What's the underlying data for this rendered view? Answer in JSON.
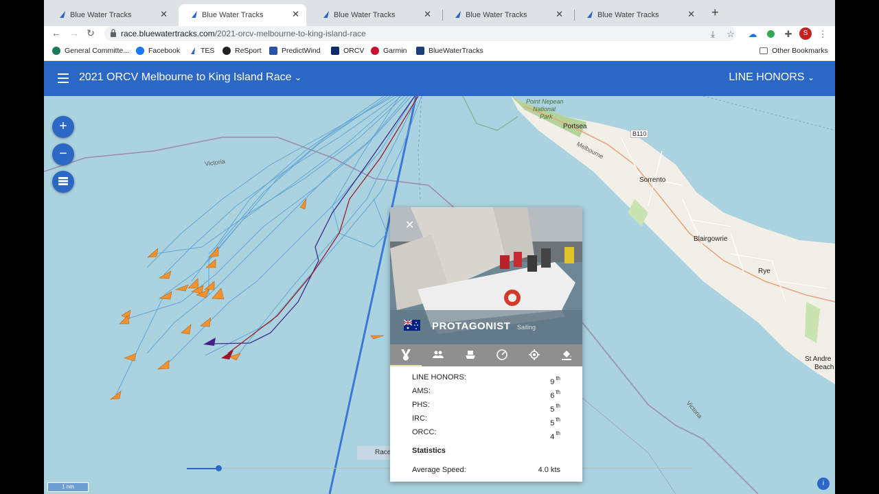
{
  "browser": {
    "tabs": [
      {
        "title": "Blue Water Tracks",
        "active": false
      },
      {
        "title": "Blue Water Tracks",
        "active": true
      },
      {
        "title": "Blue Water Tracks",
        "active": false
      },
      {
        "title": "Blue Water Tracks",
        "active": false
      },
      {
        "title": "Blue Water Tracks",
        "active": false
      }
    ],
    "url_host": "race.bluewatertracks.com",
    "url_path": "/2021-orcv-melbourne-to-king-island-race",
    "profile_initial": "S",
    "bookmarks": [
      "General Committe...",
      "Facebook",
      "TES",
      "ReSport",
      "PredictWind",
      "ORCV",
      "Garmin",
      "BlueWaterTracks"
    ],
    "other_bookmarks": "Other Bookmarks"
  },
  "app": {
    "title": "2021 ORCV Melbourne to King Island Race",
    "classification": "LINE HONORS",
    "accent": "#2b67c4"
  },
  "map": {
    "labels": {
      "point_nepean_1": "Point Nepean",
      "point_nepean_2": "National",
      "point_nepean_3": "Park",
      "portsea": "Portsea",
      "b110": "B110",
      "melbourne": "Melbourne",
      "sorrento": "Sorrento",
      "blairgowrie": "Blairgowrie",
      "rye": "Rye",
      "st_andrews_1": "St Andre",
      "st_andrews_2": "Beach",
      "victoria_1": "Victoria",
      "victoria_2": "Victoria"
    },
    "scale": "1 nm",
    "race_label": "Race",
    "info": "i"
  },
  "popup": {
    "boat_name": "PROTAGONIST",
    "boat_sub": "Sailing",
    "placings": [
      {
        "label": "LINE HONORS:",
        "value": "9",
        "suffix": "th"
      },
      {
        "label": "AMS:",
        "value": "6",
        "suffix": "th"
      },
      {
        "label": "PHS:",
        "value": "5",
        "suffix": "th"
      },
      {
        "label": "IRC:",
        "value": "5",
        "suffix": "th"
      },
      {
        "label": "ORCC:",
        "value": "4",
        "suffix": "th"
      }
    ],
    "statistics_heading": "Statistics",
    "average_speed_label": "Average Speed:",
    "average_speed_value": "4.0 kts"
  }
}
